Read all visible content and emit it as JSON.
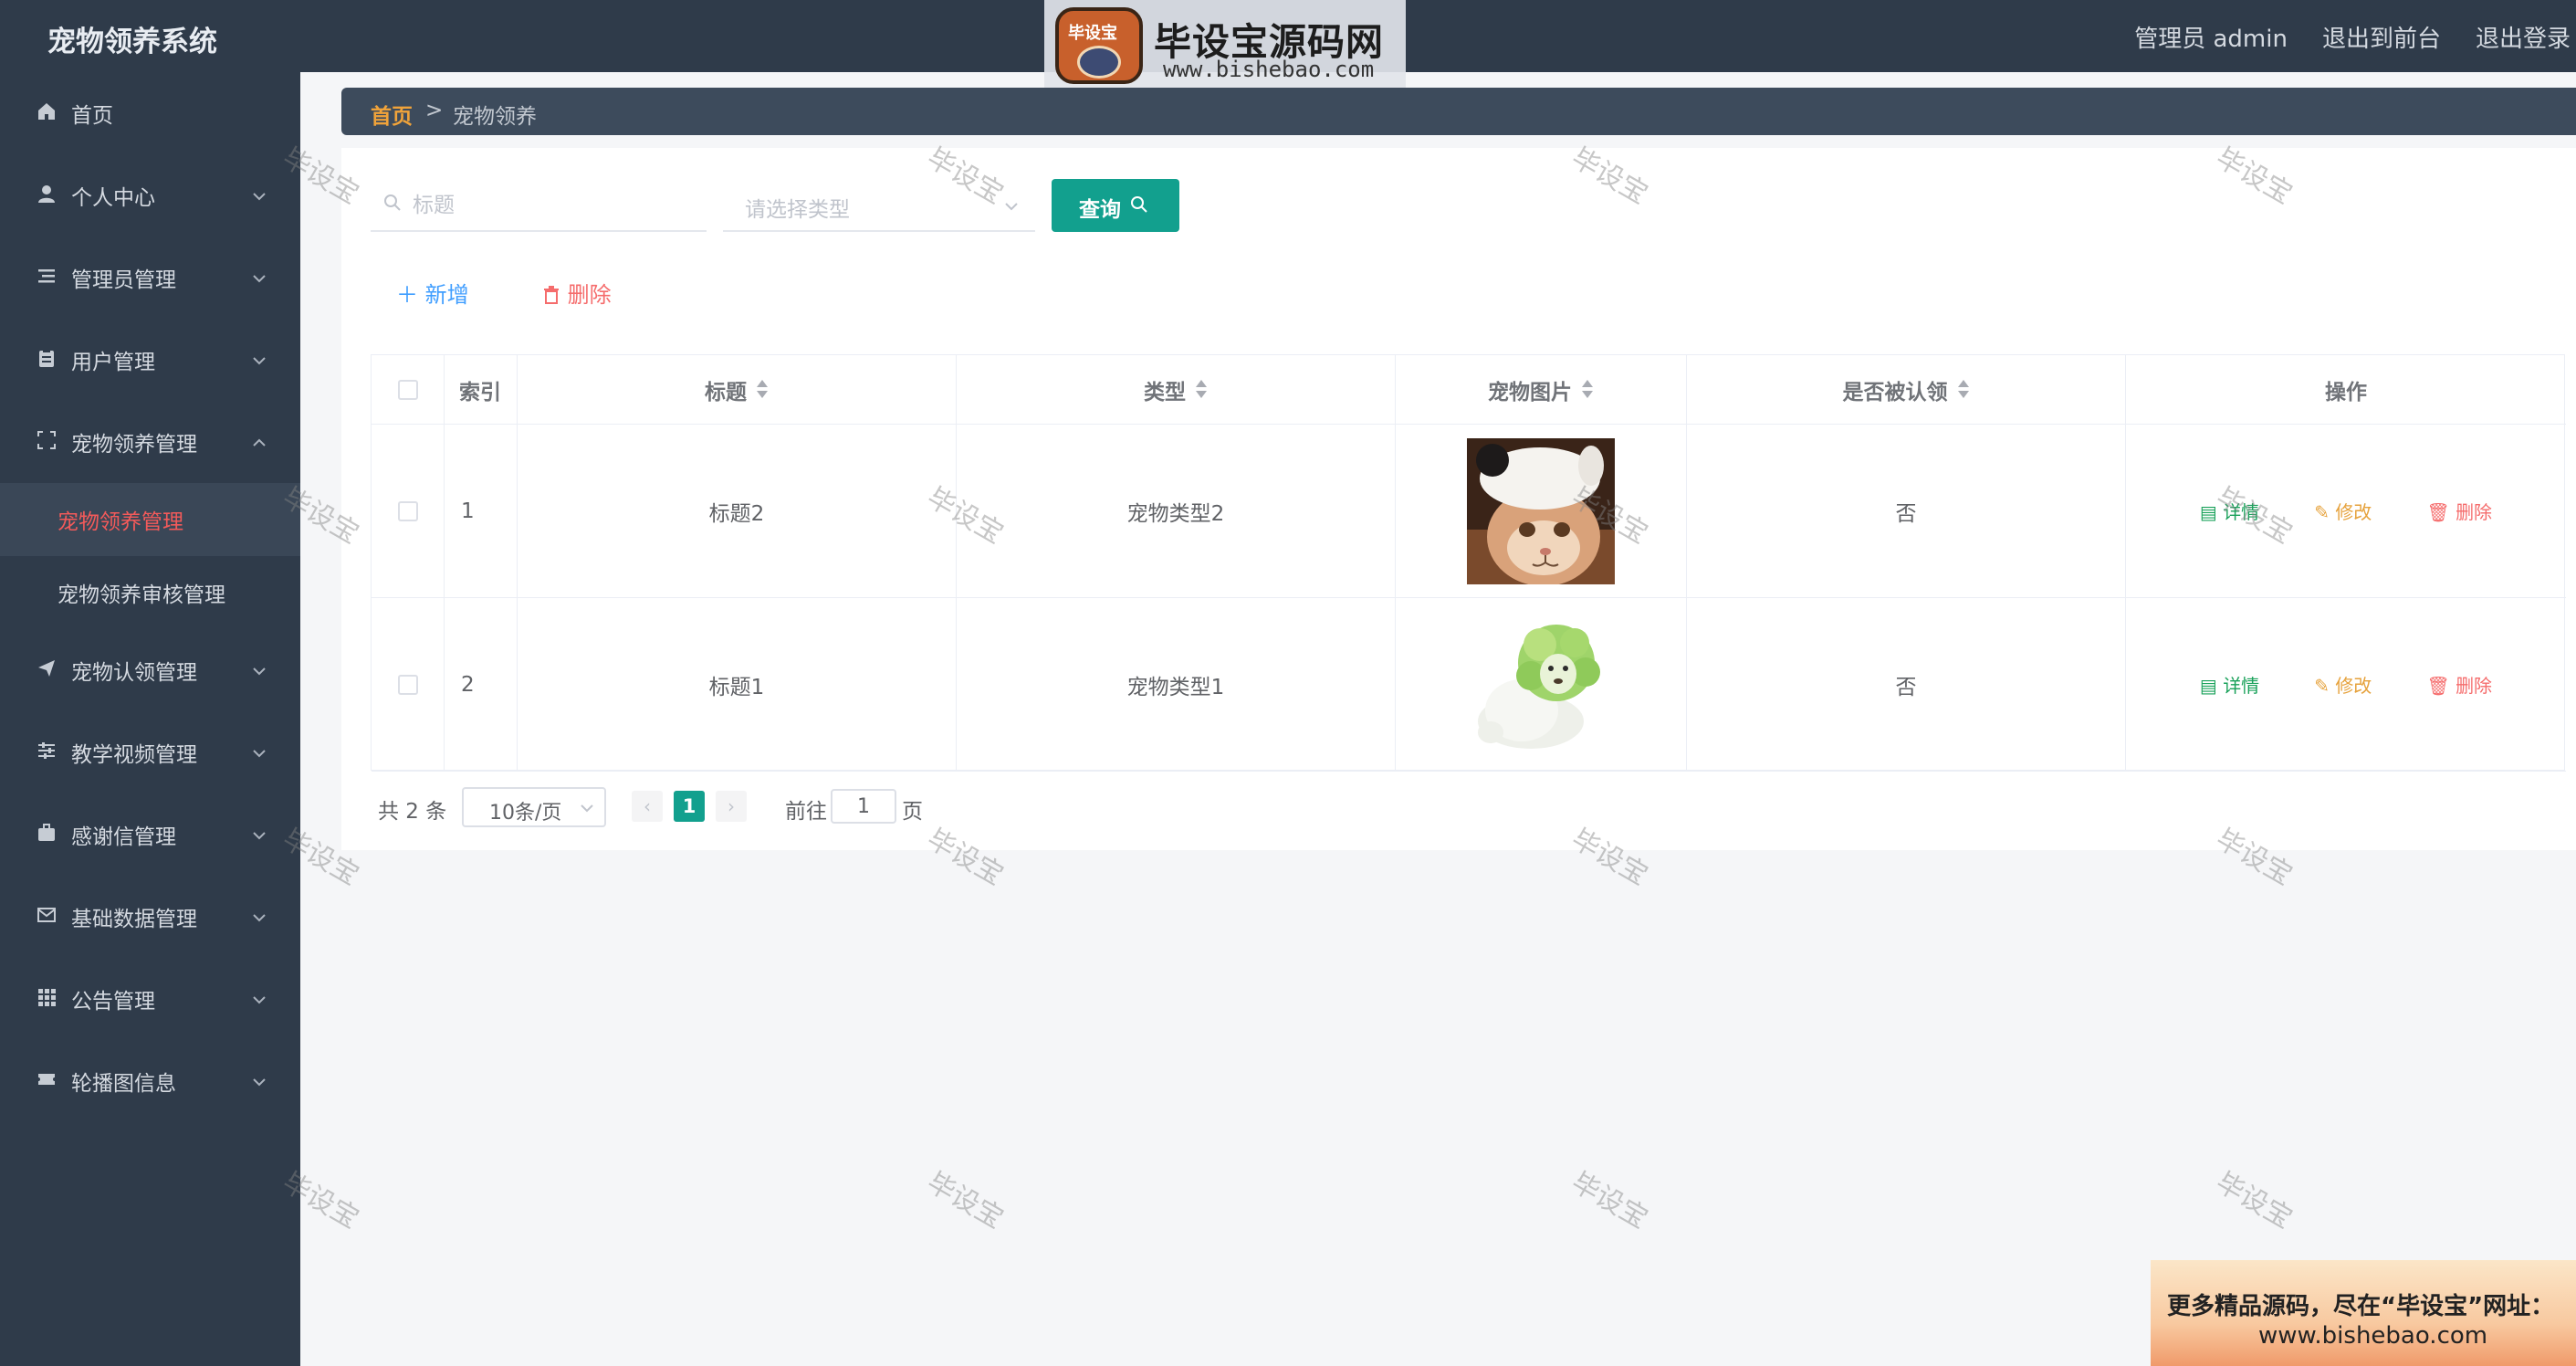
{
  "header": {
    "app_title": "宠物领养系统",
    "user_label": "管理员 admin",
    "back_front": "退出到前台",
    "logout": "退出登录"
  },
  "watermark_logo": {
    "badge": "毕设宝",
    "title": "毕设宝源码网",
    "url": "www.bishebao.com"
  },
  "sidebar": {
    "items": [
      {
        "label": "首页",
        "icon": "home-icon"
      },
      {
        "label": "个人中心",
        "icon": "user-icon"
      },
      {
        "label": "管理员管理",
        "icon": "list-icon"
      },
      {
        "label": "用户管理",
        "icon": "clipboard-icon"
      },
      {
        "label": "宠物领养管理",
        "icon": "frame-icon"
      },
      {
        "label": "宠物认领管理",
        "icon": "send-icon"
      },
      {
        "label": "教学视频管理",
        "icon": "sliders-icon"
      },
      {
        "label": "感谢信管理",
        "icon": "briefcase-icon"
      },
      {
        "label": "基础数据管理",
        "icon": "mail-icon"
      },
      {
        "label": "公告管理",
        "icon": "grid-icon"
      },
      {
        "label": "轮播图信息",
        "icon": "ticket-icon"
      }
    ],
    "sub_items": [
      {
        "label": "宠物领养管理",
        "active": true
      },
      {
        "label": "宠物领养审核管理",
        "active": false
      }
    ]
  },
  "breadcrumb": {
    "home": "首页",
    "separator": ">",
    "current": "宠物领养"
  },
  "search": {
    "title_placeholder": "标题",
    "type_placeholder": "请选择类型",
    "query_label": "查询"
  },
  "actions": {
    "add_label": "新增",
    "delete_label": "删除"
  },
  "table": {
    "columns": [
      "索引",
      "标题",
      "类型",
      "宠物图片",
      "是否被认领",
      "操作"
    ],
    "rows": [
      {
        "index": "1",
        "title": "标题2",
        "type": "宠物类型2",
        "image": "cat-in-hat-photo",
        "claimed": "否"
      },
      {
        "index": "2",
        "title": "标题1",
        "type": "宠物类型1",
        "image": "cabbage-dog-photo",
        "claimed": "否"
      }
    ],
    "row_actions": {
      "detail": "详情",
      "edit": "修改",
      "remove": "删除"
    }
  },
  "pagination": {
    "total": "共 2 条",
    "page_size": "10条/页",
    "current_page": "1",
    "goto_prefix": "前往",
    "goto_value": "1",
    "goto_suffix": "页"
  },
  "watermark_text": "毕设宝",
  "ad": {
    "line1": "更多精品源码，尽在“毕设宝”网址：",
    "line2": "www.bishebao.com"
  },
  "colors": {
    "sidebar_bg": "#2f3b4a",
    "accent": "#12a08e",
    "active_menu": "#f35a5a",
    "breadcrumb_home": "#f0a33a"
  }
}
